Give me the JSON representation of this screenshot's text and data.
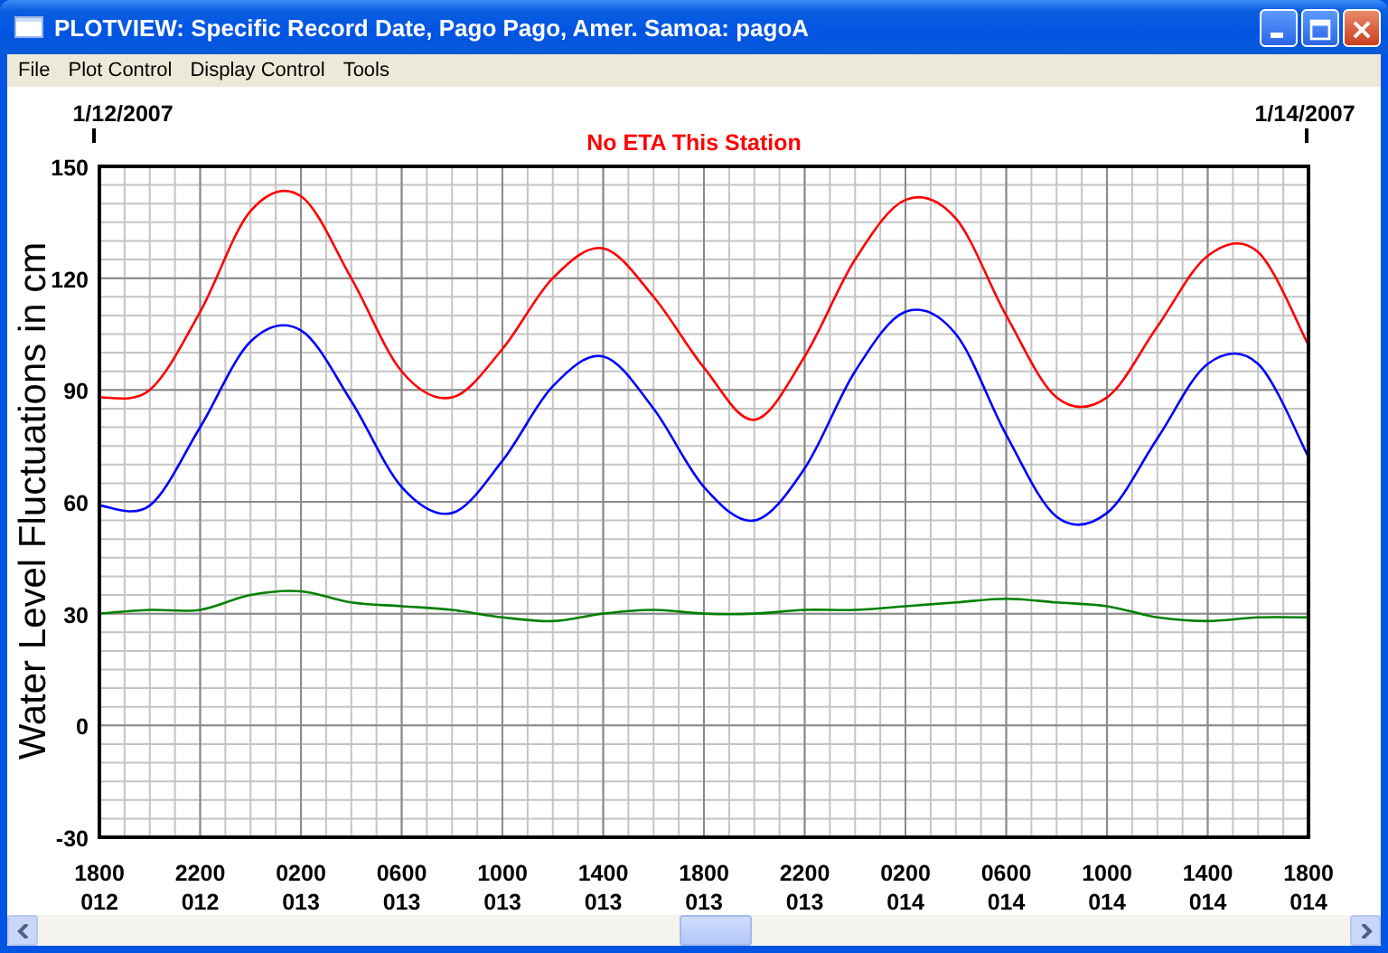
{
  "window": {
    "title": "PLOTVIEW: Specific Record Date, Pago Pago, Amer. Samoa: pagoA"
  },
  "menu": [
    "File",
    "Plot Control",
    "Display Control",
    "Tools"
  ],
  "plot": {
    "start_date": "1/12/2007",
    "end_date": "1/14/2007",
    "chart_data": {
      "type": "line",
      "title": "No ETA This Station",
      "ylabel": "Water Level Fluctuations in cm",
      "categories": [
        "1800\n012",
        null,
        "2200\n012",
        null,
        "0200\n013",
        null,
        "0600\n013",
        null,
        "1000\n013",
        null,
        "1400\n013",
        null,
        "1800\n013",
        null,
        "2200\n013",
        null,
        "0200\n014",
        null,
        "0600\n014",
        null,
        "1000\n014",
        null,
        "1400\n014",
        null,
        "1800\n014"
      ],
      "ylim": [
        -30,
        150
      ],
      "grid": true,
      "yticks": [
        -30,
        0,
        30,
        60,
        90,
        120,
        150
      ],
      "series": [
        {
          "color": "#ff0000",
          "values": [
            88,
            90,
            111,
            138,
            142,
            120,
            95,
            88,
            101,
            120,
            128,
            115,
            96,
            82,
            99,
            125,
            141,
            136,
            110,
            88,
            88,
            107,
            126,
            127,
            102
          ]
        },
        {
          "color": "#0000ff",
          "values": [
            59,
            59,
            80,
            103,
            106,
            87,
            64,
            57,
            71,
            91,
            99,
            85,
            64,
            55,
            69,
            95,
            111,
            105,
            78,
            56,
            57,
            77,
            97,
            97,
            72
          ]
        },
        {
          "color": "#008000",
          "values": [
            30,
            31,
            31,
            35,
            36,
            33,
            32,
            31,
            29,
            28,
            30,
            31,
            30,
            30,
            31,
            31,
            32,
            33,
            34,
            33,
            32,
            29,
            28,
            29,
            29
          ]
        }
      ]
    }
  }
}
